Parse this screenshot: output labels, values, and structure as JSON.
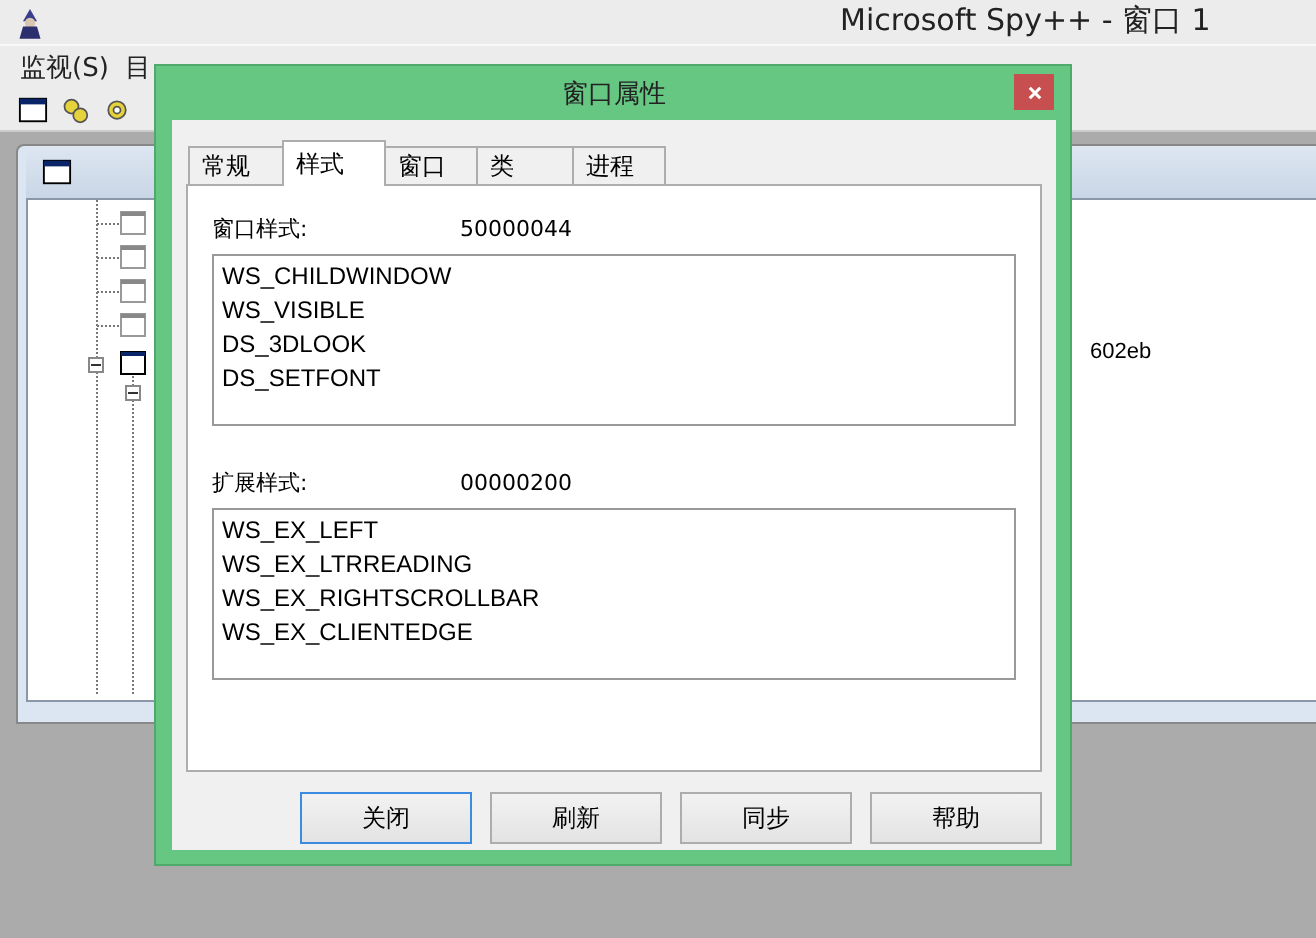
{
  "app": {
    "title": "Microsoft Spy++ - 窗口 1"
  },
  "menu": [
    "监视(S)",
    "目"
  ],
  "child_window": {
    "partial_text": "602eb"
  },
  "dialog": {
    "title": "窗口属性",
    "tabs": [
      {
        "label": "常规",
        "selected": false
      },
      {
        "label": "样式",
        "selected": true
      },
      {
        "label": "窗口",
        "selected": false
      },
      {
        "label": "类",
        "selected": false
      },
      {
        "label": "进程",
        "selected": false
      }
    ],
    "sections": [
      {
        "label": "窗口样式:",
        "value": "50000044",
        "items": [
          "WS_CHILDWINDOW",
          "WS_VISIBLE",
          "DS_3DLOOK",
          "DS_SETFONT"
        ]
      },
      {
        "label": "扩展样式:",
        "value": "00000200",
        "items": [
          "WS_EX_LEFT",
          "WS_EX_LTRREADING",
          "WS_EX_RIGHTSCROLLBAR",
          "WS_EX_CLIENTEDGE"
        ]
      }
    ],
    "buttons": [
      {
        "label": "关闭",
        "focused": true
      },
      {
        "label": "刷新",
        "focused": false
      },
      {
        "label": "同步",
        "focused": false
      },
      {
        "label": "帮助",
        "focused": false
      }
    ]
  }
}
